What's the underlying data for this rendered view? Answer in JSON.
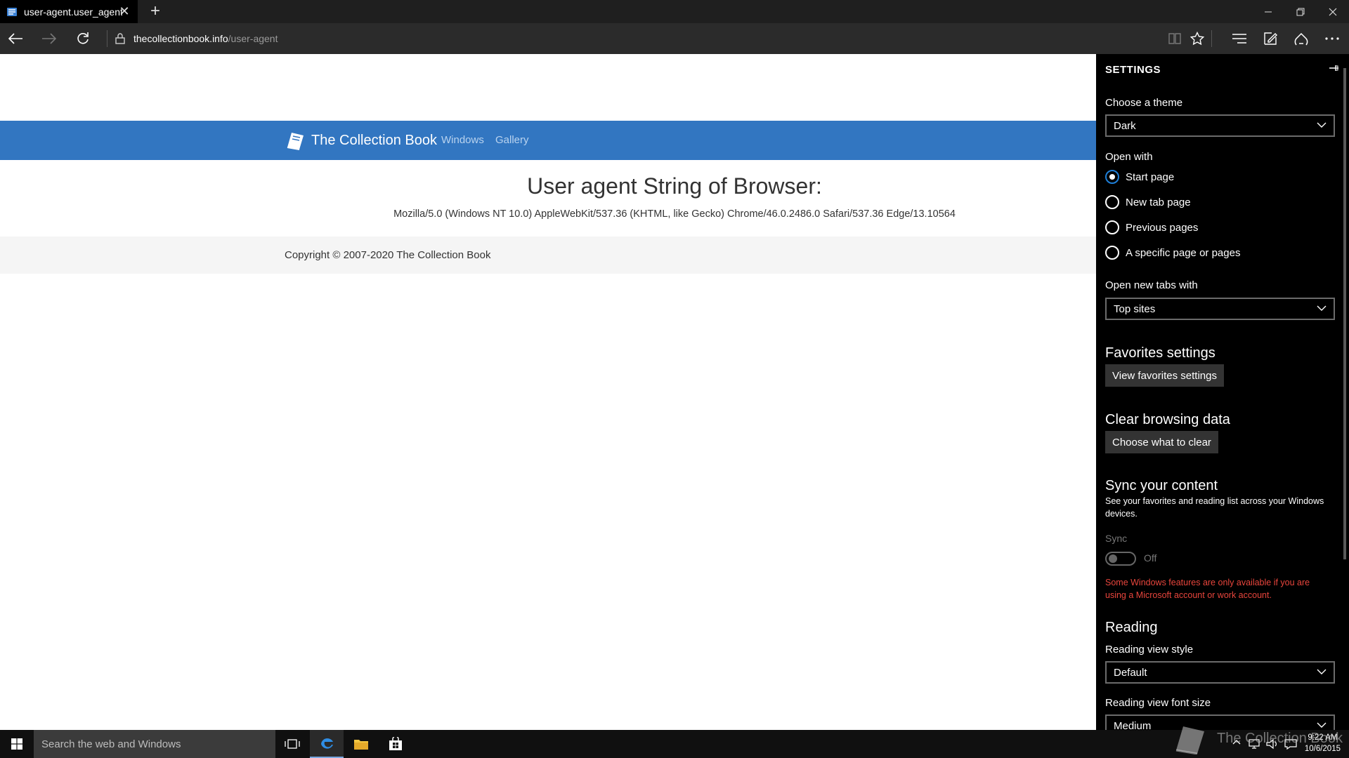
{
  "tab": {
    "title": "user-agent.user_agent -",
    "close": "✕"
  },
  "newtab_symbol": "+",
  "address": {
    "host": "thecollectionbook.info",
    "path": "/user-agent"
  },
  "site": {
    "brand": "The Collection Book",
    "nav": [
      "Windows",
      "Gallery"
    ],
    "heading": "User agent String of Browser:",
    "ua": "Mozilla/5.0 (Windows NT 10.0) AppleWebKit/537.36 (KHTML, like Gecko) Chrome/46.0.2486.0 Safari/537.36 Edge/13.10564",
    "copyright": "Copyright © 2007-2020 The Collection Book"
  },
  "settings": {
    "title": "SETTINGS",
    "theme_label": "Choose a theme",
    "theme_value": "Dark",
    "open_with_label": "Open with",
    "open_with_options": [
      "Start page",
      "New tab page",
      "Previous pages",
      "A specific page or pages"
    ],
    "open_with_selected": "Start page",
    "new_tabs_label": "Open new tabs with",
    "new_tabs_value": "Top sites",
    "favorites_title": "Favorites settings",
    "favorites_button": "View favorites settings",
    "clear_title": "Clear browsing data",
    "clear_button": "Choose what to clear",
    "sync_title": "Sync your content",
    "sync_desc": "See your favorites and reading list across your Windows devices.",
    "sync_label": "Sync",
    "sync_state": "Off",
    "sync_warning": "Some Windows features are only available if you are using a Microsoft account or work account.",
    "reading_title": "Reading",
    "reading_style_label": "Reading view style",
    "reading_style_value": "Default",
    "reading_font_label": "Reading view font size",
    "reading_font_value": "Medium"
  },
  "taskbar": {
    "search_placeholder": "Search the web and Windows",
    "time": "9:22 AM",
    "date": "10/6/2015"
  },
  "watermark": "The Collection Book",
  "colors": {
    "site_nav": "#3276c1",
    "warning": "#e8453c",
    "radio_selected": "#1e7fd8"
  }
}
